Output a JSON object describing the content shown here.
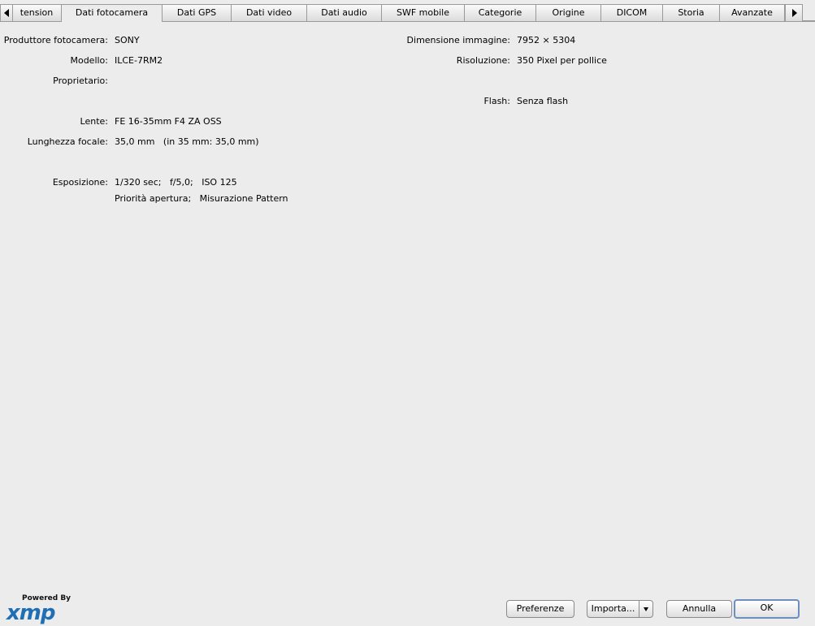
{
  "tabs": [
    {
      "label": "tension"
    },
    {
      "label": "Dati fotocamera"
    },
    {
      "label": "Dati GPS"
    },
    {
      "label": "Dati video"
    },
    {
      "label": "Dati audio"
    },
    {
      "label": "SWF mobile"
    },
    {
      "label": "Categorie"
    },
    {
      "label": "Origine"
    },
    {
      "label": "DICOM"
    },
    {
      "label": "Storia"
    },
    {
      "label": "Avanzate"
    }
  ],
  "active_tab": "Dati fotocamera",
  "left_fields": {
    "produttore": {
      "label": "Produttore fotocamera:",
      "value": "SONY"
    },
    "modello": {
      "label": "Modello:",
      "value": "ILCE-7RM2"
    },
    "proprietario": {
      "label": "Proprietario:",
      "value": ""
    },
    "lente": {
      "label": "Lente:",
      "value": "FE 16-35mm F4 ZA OSS"
    },
    "lunghezza": {
      "label": "Lunghezza focale:",
      "value": "35,0 mm   (in 35 mm: 35,0 mm)"
    },
    "esposizione": {
      "label": "Esposizione:",
      "value": "1/320 sec;   f/5,0;   ISO 125",
      "value2": "Priorità apertura;   Misurazione Pattern"
    }
  },
  "right_fields": {
    "dimensione": {
      "label": "Dimensione immagine:",
      "value": "7952 × 5304"
    },
    "risoluzione": {
      "label": "Risoluzione:",
      "value": "350 Pixel per pollice"
    },
    "flash": {
      "label": "Flash:",
      "value": "Senza flash"
    }
  },
  "logo": {
    "powered": "Powered By",
    "brand": "xmp"
  },
  "buttons": {
    "preferenze": "Preferenze",
    "importa": "Importa...",
    "annulla": "Annulla",
    "ok": "OK"
  },
  "colors": {
    "background": "#ececec",
    "logo": "#1f6fb5",
    "default_button_border": "#6a8fc0"
  }
}
